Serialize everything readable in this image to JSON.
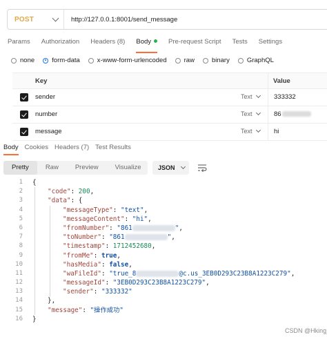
{
  "request": {
    "method": "POST",
    "url": "http://127.0.0.1:8001/send_message"
  },
  "request_tabs": [
    {
      "label": "Params",
      "active": false
    },
    {
      "label": "Authorization",
      "active": false
    },
    {
      "label": "Headers (8)",
      "active": false
    },
    {
      "label": "Body",
      "active": true
    },
    {
      "label": "Pre-request Script",
      "active": false
    },
    {
      "label": "Tests",
      "active": false
    },
    {
      "label": "Settings",
      "active": false
    }
  ],
  "body_types": [
    {
      "label": "none",
      "selected": false
    },
    {
      "label": "form-data",
      "selected": true
    },
    {
      "label": "x-www-form-urlencoded",
      "selected": false
    },
    {
      "label": "raw",
      "selected": false
    },
    {
      "label": "binary",
      "selected": false
    },
    {
      "label": "GraphQL",
      "selected": false
    }
  ],
  "params_table": {
    "headers": {
      "key": "Key",
      "value": "Value"
    },
    "rows": [
      {
        "key": "sender",
        "type": "Text",
        "value": "333332",
        "checked": true
      },
      {
        "key": "number",
        "type": "Text",
        "value": "86",
        "checked": true,
        "value_redacted": true
      },
      {
        "key": "message",
        "type": "Text",
        "value": "hi",
        "checked": true
      }
    ]
  },
  "response_tabs": [
    {
      "label": "Body",
      "active": true
    },
    {
      "label": "Cookies",
      "active": false
    },
    {
      "label": "Headers (7)",
      "active": false
    },
    {
      "label": "Test Results",
      "active": false
    }
  ],
  "response_formats": [
    {
      "label": "Pretty",
      "active": true
    },
    {
      "label": "Raw",
      "active": false
    },
    {
      "label": "Preview",
      "active": false
    },
    {
      "label": "Visualize",
      "active": false
    }
  ],
  "response_language": "JSON",
  "code_lines": [
    {
      "num": "1",
      "tokens": [
        [
          "pun",
          "{"
        ]
      ]
    },
    {
      "num": "2",
      "tokens": [
        [
          "key",
          "\"code\""
        ],
        [
          "pun",
          ": "
        ],
        [
          "num",
          "200"
        ],
        [
          "pun",
          ","
        ]
      ]
    },
    {
      "num": "3",
      "tokens": [
        [
          "key",
          "\"data\""
        ],
        [
          "pun",
          ": {"
        ]
      ]
    },
    {
      "num": "4",
      "tokens": [
        [
          "key",
          "\"messageType\""
        ],
        [
          "pun",
          ": "
        ],
        [
          "str",
          "\"text\""
        ],
        [
          "pun",
          ","
        ]
      ]
    },
    {
      "num": "5",
      "tokens": [
        [
          "key",
          "\"messageContent\""
        ],
        [
          "pun",
          ": "
        ],
        [
          "str",
          "\"hi\""
        ],
        [
          "pun",
          ","
        ]
      ]
    },
    {
      "num": "6",
      "tokens": [
        [
          "key",
          "\"fromNumber\""
        ],
        [
          "pun",
          ": "
        ],
        [
          "str",
          "\"861"
        ],
        [
          "blur",
          ""
        ],
        [
          "str",
          "\""
        ],
        [
          "pun",
          ","
        ]
      ]
    },
    {
      "num": "7",
      "tokens": [
        [
          "key",
          "\"toNumber\""
        ],
        [
          "pun",
          ": "
        ],
        [
          "str",
          "\"861"
        ],
        [
          "blur",
          ""
        ],
        [
          "str",
          "\""
        ],
        [
          "pun",
          ","
        ]
      ]
    },
    {
      "num": "8",
      "tokens": [
        [
          "key",
          "\"timestamp\""
        ],
        [
          "pun",
          ": "
        ],
        [
          "num",
          "1712452680"
        ],
        [
          "pun",
          ","
        ]
      ]
    },
    {
      "num": "9",
      "tokens": [
        [
          "key",
          "\"fromMe\""
        ],
        [
          "pun",
          ": "
        ],
        [
          "bool",
          "true"
        ],
        [
          "pun",
          ","
        ]
      ]
    },
    {
      "num": "10",
      "tokens": [
        [
          "key",
          "\"hasMedia\""
        ],
        [
          "pun",
          ": "
        ],
        [
          "bool",
          "false"
        ],
        [
          "pun",
          ","
        ]
      ]
    },
    {
      "num": "11",
      "tokens": [
        [
          "key",
          "\"waFileId\""
        ],
        [
          "pun",
          ": "
        ],
        [
          "str",
          "\"true_8"
        ],
        [
          "blur",
          ""
        ],
        [
          "str",
          "@c.us_3EB0D293C23B8A1223C279\""
        ],
        [
          "pun",
          ","
        ]
      ]
    },
    {
      "num": "12",
      "tokens": [
        [
          "key",
          "\"messageId\""
        ],
        [
          "pun",
          ": "
        ],
        [
          "str",
          "\"3EB0D293C23B8A1223C279\""
        ],
        [
          "pun",
          ","
        ]
      ]
    },
    {
      "num": "13",
      "tokens": [
        [
          "key",
          "\"sender\""
        ],
        [
          "pun",
          ": "
        ],
        [
          "str",
          "\"333332\""
        ]
      ]
    },
    {
      "num": "14",
      "tokens": [
        [
          "pun",
          "},"
        ]
      ]
    },
    {
      "num": "15",
      "tokens": [
        [
          "key",
          "\"message\""
        ],
        [
          "pun",
          ": "
        ],
        [
          "str",
          "\"操作成功\""
        ]
      ]
    },
    {
      "num": "16",
      "tokens": [
        [
          "pun",
          "}"
        ]
      ]
    }
  ],
  "code_indent": [
    0,
    1,
    1,
    2,
    2,
    2,
    2,
    2,
    2,
    2,
    2,
    2,
    2,
    1,
    1,
    0
  ],
  "watermark": "CSDN @Hking_"
}
